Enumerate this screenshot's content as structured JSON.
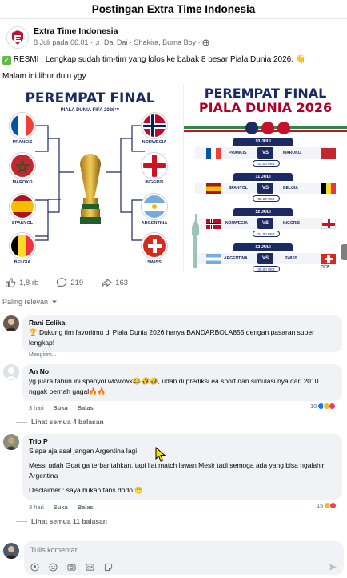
{
  "header": {
    "title": "Postingan Extra Time Indonesia"
  },
  "post": {
    "page_name": "Extra Time Indonesia",
    "meta": "8 Juli pada 06.01 · ♬ Dai Dai · Shakira, Burna Boy ·",
    "text_line1": "RESMI : Lengkap sudah tim-tim yang lolos ke babak 8 besar Piala Dunia 2026. 👋",
    "text_line2": "Malam ini libur dulu ygy."
  },
  "image_left": {
    "title": "PEREMPAT FINAL",
    "subtitle": "PIALA DUNIA FIFA 2026™",
    "teams_left": [
      "PRANCIS",
      "MAROKO",
      "SPANYOL",
      "BELGIA"
    ],
    "teams_right": [
      "NORWEGIA",
      "INGGRIS",
      "ARGENTINA",
      "SWISS"
    ]
  },
  "image_right": {
    "title1": "PEREMPAT FINAL",
    "title2": "PIALA DUNIA 2026",
    "matches": [
      {
        "date": "10 JULI",
        "home": "PRANCIS",
        "away": "MAROKO",
        "time": "03.00 WIB"
      },
      {
        "date": "11 JULI",
        "home": "SPANYOL",
        "away": "BELGIA",
        "time": "02.00 WIB"
      },
      {
        "date": "12 JULI",
        "home": "NORWEGIA",
        "away": "INGGRIS",
        "time": "04.00 WIB"
      },
      {
        "date": "12 JULI",
        "home": "ARGENTINA",
        "away": "SWISS",
        "time": "08.00 WIB"
      }
    ],
    "vs": "VS",
    "footer": "FIFA"
  },
  "stats": {
    "likes": "1,8 rb",
    "comments": "219",
    "shares": "163"
  },
  "sort_label": "Paling relevan",
  "comments": [
    {
      "name": "Rani Eelika",
      "text": "🏆 Dukung tim favoritmu di Piala Dunia 2026 hanya BANDARBOLA855 dengan pasaran super lengkap!",
      "status": "Mengirim..."
    },
    {
      "name": "An No",
      "text": "yg juara tahun ini spanyol wkwkwk😂🤣🤣, udah di prediksi ea sport dan simulasi nya dari 2010 nggak pernah gagal🔥🔥",
      "time": "3 hari",
      "like": "Suka",
      "reply": "Balas",
      "reactions": "10",
      "more_replies": "Lihat semua 4 balasan"
    },
    {
      "name": "Trio P",
      "text1": "Siapa aja asal jangan Argentina lagi",
      "text2": "Messi udah Goat ga terbantahkan, tapi liat match lawan Mesir tadi semoga ada yang bisa ngalahin Argentina",
      "text3": "Disclaimer : saya bukan fans dodo 😁",
      "time": "3 hari",
      "like": "Suka",
      "reply": "Balas",
      "reactions": "15",
      "more_replies": "Lihat semua 11 balasan"
    }
  ],
  "composer": {
    "placeholder": "Tulis komentar..."
  },
  "colors": {
    "fb_blue": "#1877f2",
    "navy": "#1b2a62",
    "muted": "#65676b"
  }
}
